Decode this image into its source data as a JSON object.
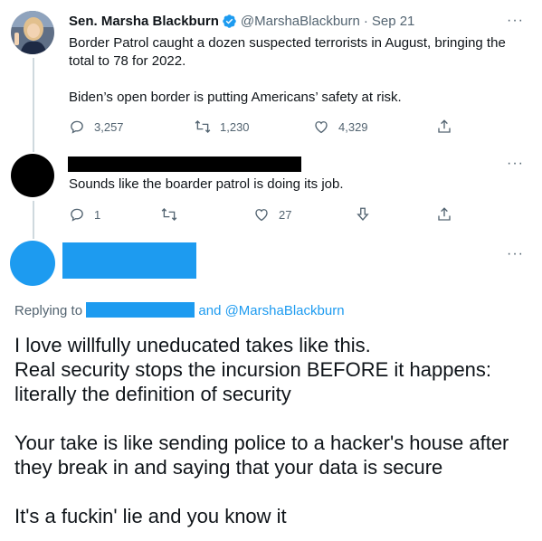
{
  "tweet1": {
    "author_name": "Sen. Marsha Blackburn",
    "handle": "@MarshaBlackburn",
    "separator": "·",
    "date": "Sep 21",
    "text": "Border Patrol caught a dozen suspected terrorists in August, bringing the total to 78 for 2022.\n\nBiden’s open border is putting Americans’ safety at risk.",
    "replies": "3,257",
    "retweets": "1,230",
    "likes": "4,329",
    "more": "···"
  },
  "tweet2": {
    "text": "Sounds like the boarder patrol is doing its job.",
    "replies": "1",
    "likes": "27",
    "more": "···"
  },
  "tweet3": {
    "more": "···",
    "replying_to": "Replying to",
    "and_handle": "and @MarshaBlackburn",
    "text": "I love willfully uneducated takes like this.\nReal security stops the incursion BEFORE it happens: literally the definition of security\n\nYour take is like sending police to a hacker's house after they break in and saying that your data is secure\n\nIt's a fuckin' lie and you know it"
  },
  "colors": {
    "accent": "#1d9bf0",
    "redaction_black": "#000000",
    "muted": "#536471",
    "thread_line": "#cfd9de"
  },
  "icons": [
    "verified-badge-icon",
    "reply-icon",
    "retweet-icon",
    "like-icon",
    "share-icon",
    "downvote-icon",
    "more-icon"
  ]
}
